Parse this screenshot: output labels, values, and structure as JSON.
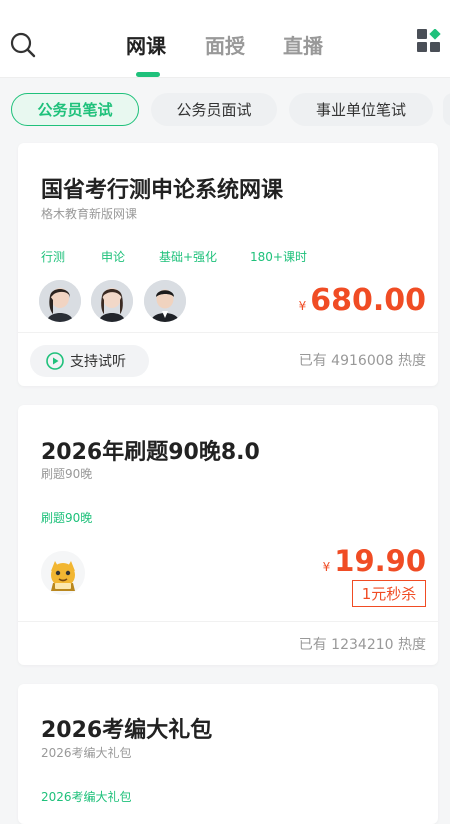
{
  "header": {
    "search_icon": "search-icon",
    "tabs": [
      {
        "label": "网课",
        "active": true
      },
      {
        "label": "面授",
        "active": false
      },
      {
        "label": "直播",
        "active": false
      }
    ],
    "grid_icon": "category-grid-icon",
    "accent_color": "#1fc17b"
  },
  "chips": [
    {
      "label": "公务员笔试",
      "active": true
    },
    {
      "label": "公务员面试",
      "active": false
    },
    {
      "label": "事业单位笔试",
      "active": false
    }
  ],
  "courses": [
    {
      "title": "国省考行测申论系统网课",
      "subtitle": "格木教育新版网课",
      "tags": [
        "行测",
        "申论",
        "基础+强化",
        "180+课时"
      ],
      "teachers": [
        "teacher-avatar",
        "teacher-avatar",
        "teacher-avatar"
      ],
      "currency": "¥",
      "price": "680.00",
      "trial_label": "支持试听",
      "heat_text": "已有 4916008 热度"
    },
    {
      "title": "2026年刷题90晚8.0",
      "subtitle": "刷题90晚",
      "tags": [
        "刷题90晚"
      ],
      "currency": "¥",
      "price": "19.90",
      "badge": "1元秒杀",
      "heat_text": "已有 1234210 热度"
    },
    {
      "title": "2026考编大礼包",
      "subtitle": "2026考编大礼包",
      "tags": [
        "2026考编大礼包"
      ]
    }
  ],
  "colors": {
    "price": "#f04c24",
    "accent": "#1fc17b"
  }
}
